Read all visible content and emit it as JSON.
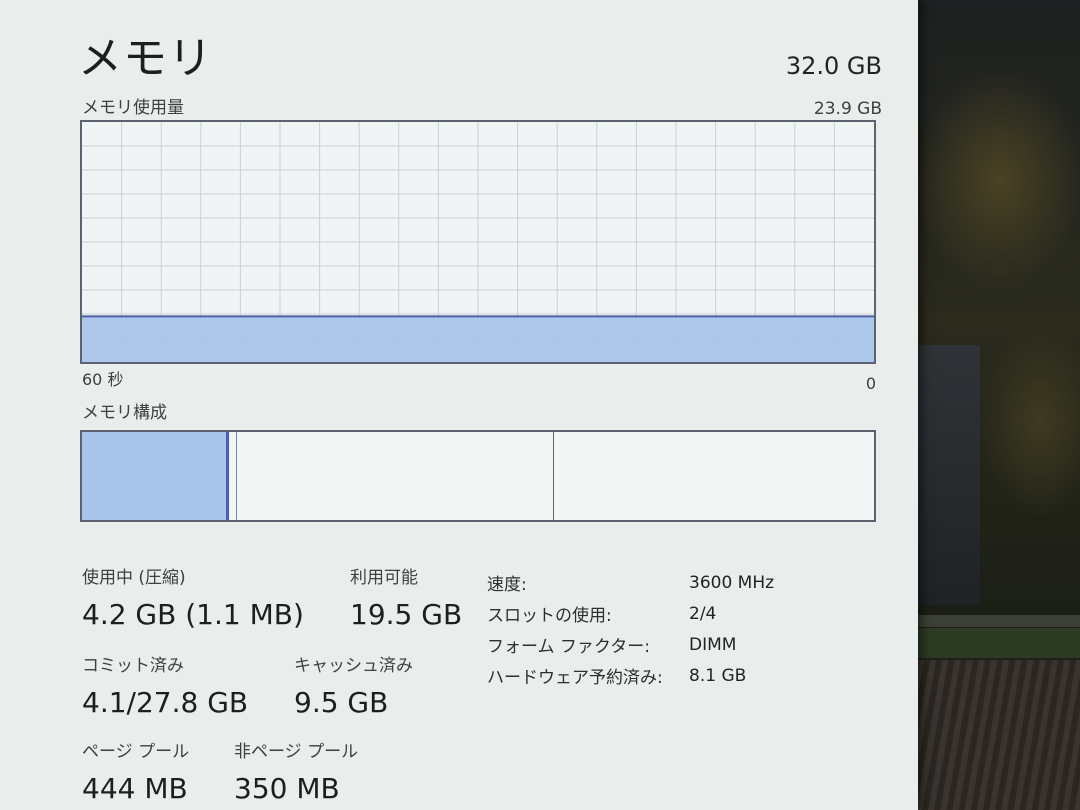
{
  "window": {
    "title": "メモリ",
    "total_capacity": "32.0 GB"
  },
  "usage_graph": {
    "label": "メモリ使用量",
    "max_label": "23.9 GB",
    "time_left": "60 秒",
    "time_right": "0",
    "usage_fraction": 0.19,
    "colors": {
      "fill": "#a9c4ea",
      "line": "#4f5fa3",
      "grid": "#c7d2d6"
    }
  },
  "composition": {
    "label": "メモリ構成",
    "in_use_fraction": 0.185,
    "modified_fraction": 0.01,
    "standby_fraction": 0.4
  },
  "stats": [
    {
      "label": "使用中 (圧縮)",
      "value": "4.2 GB (1.1 MB)"
    },
    {
      "label": "利用可能",
      "value": "19.5 GB"
    },
    {
      "label": "コミット済み",
      "value": "4.1/27.8 GB"
    },
    {
      "label": "キャッシュ済み",
      "value": "9.5 GB"
    },
    {
      "label": "ページ プール",
      "value": "444 MB"
    },
    {
      "label": "非ページ プール",
      "value": "350 MB"
    }
  ],
  "specs": [
    {
      "key": "速度:",
      "value": "3600 MHz"
    },
    {
      "key": "スロットの使用:",
      "value": "2/4"
    },
    {
      "key": "フォーム ファクター:",
      "value": "DIMM"
    },
    {
      "key": "ハードウェア予約済み:",
      "value": "8.1 GB"
    }
  ]
}
